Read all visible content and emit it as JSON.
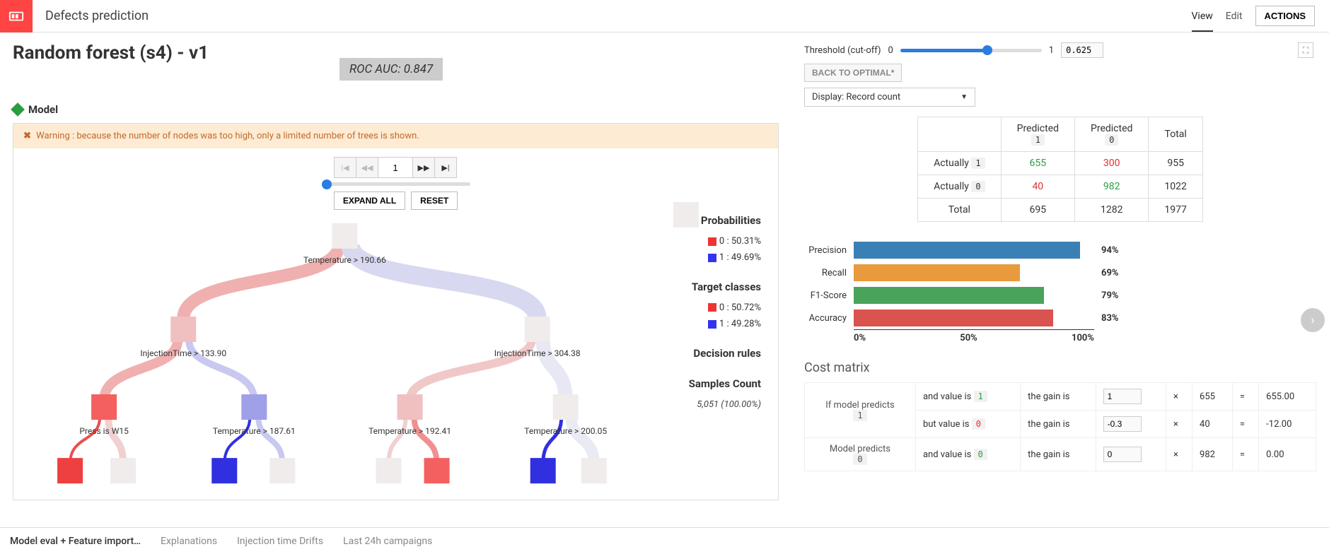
{
  "header": {
    "app_title": "Defects prediction",
    "view": "View",
    "edit": "Edit",
    "actions": "ACTIONS"
  },
  "page": {
    "title": "Random forest (s4) - v1",
    "roc_auc": "ROC AUC: 0.847",
    "model_label": "Model"
  },
  "warning": "Warning : because the number of nodes was too high, only a limited number of trees is shown.",
  "pager": {
    "value": "1"
  },
  "tree_buttons": {
    "expand": "EXPAND ALL",
    "reset": "RESET"
  },
  "tree_labels": {
    "root": "Temperature > 190.66",
    "l1a": "InjectionTime > 133.90",
    "l1b": "InjectionTime > 304.38",
    "l2a": "Press is W15",
    "l2b": "Temperature > 187.61",
    "l2c": "Temperature > 192.41",
    "l2d": "Temperature > 200.05"
  },
  "legend": {
    "prob_hdr": "Probabilities",
    "prob0": "0 : 50.31%",
    "prob1": "1 : 49.69%",
    "target_hdr": "Target classes",
    "target0": "0 : 50.72%",
    "target1": "1 : 49.28%",
    "rules_hdr": "Decision rules",
    "samples_hdr": "Samples Count",
    "samples_val": "5,051 (100.00%)"
  },
  "threshold": {
    "label": "Threshold (cut-off)",
    "min": "0",
    "max": "1",
    "value": "0.625",
    "back": "BACK TO OPTIMAL*"
  },
  "display": {
    "prefix": "Display: ",
    "value": "Record count"
  },
  "confusion": {
    "pred1": "Predicted",
    "pred0": "Predicted",
    "total": "Total",
    "act1": "Actually",
    "act0": "Actually",
    "c11": "655",
    "c10": "300",
    "r1t": "955",
    "c01": "40",
    "c00": "982",
    "r0t": "1022",
    "ct1": "695",
    "ct0": "1282",
    "gt": "1977"
  },
  "chart_data": {
    "type": "bar",
    "categories": [
      "Precision",
      "Recall",
      "F1-Score",
      "Accuracy"
    ],
    "values": [
      94,
      69,
      79,
      83
    ],
    "colors": [
      "#3a80b5",
      "#e89a3c",
      "#4aa35a",
      "#d9534f"
    ],
    "xlim": [
      0,
      100
    ],
    "xticks": [
      "0%",
      "50%",
      "100%"
    ]
  },
  "cost": {
    "title": "Cost matrix",
    "if_predicts": "If model predicts",
    "model_predicts": "Model predicts",
    "and_value": "and value is",
    "but_value": "but value is",
    "gain_is": "the gain is",
    "rows": [
      {
        "val": "1",
        "gain": "1",
        "mult": "655",
        "res": "655.00"
      },
      {
        "val": "0",
        "gain": "-0.3",
        "mult": "40",
        "res": "-12.00"
      },
      {
        "val": "0",
        "gain": "0",
        "mult": "982",
        "res": "0.00"
      }
    ]
  },
  "bottom_tabs": [
    "Model eval + Feature import…",
    "Explanations",
    "Injection time Drifts",
    "Last 24h campaigns"
  ]
}
